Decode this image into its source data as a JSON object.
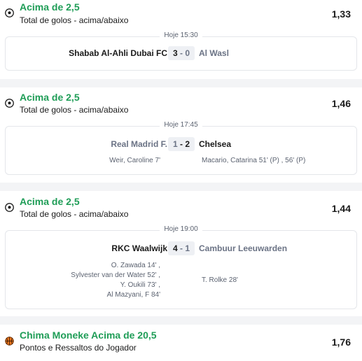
{
  "bets": [
    {
      "selection": "Acima de 2,5",
      "market": "Total de golos - acima/abaixo",
      "odds": "1,33",
      "sport_icon": "soccer-ball-icon",
      "time": "Hoje 15:30",
      "home": "Shabab Al-Ahli Dubai FC",
      "home_score": "3",
      "away_score": "0",
      "away": "Al Wasl",
      "home_scorers": [],
      "away_scorers": []
    },
    {
      "selection": "Acima de 2,5",
      "market": "Total de golos - acima/abaixo",
      "odds": "1,46",
      "sport_icon": "soccer-ball-icon",
      "time": "Hoje 17:45",
      "home": "Real Madrid F.",
      "home_score": "1",
      "away_score": "2",
      "away": "Chelsea",
      "home_scorers": [
        "Weir, Caroline 7'"
      ],
      "away_scorers": [
        "Macario, Catarina 51'  (P) , 56'  (P)"
      ]
    },
    {
      "selection": "Acima de 2,5",
      "market": "Total de golos - acima/abaixo",
      "odds": "1,44",
      "sport_icon": "soccer-ball-icon",
      "time": "Hoje 19:00",
      "home": "RKC Waalwijk",
      "home_score": "4",
      "away_score": "1",
      "away": "Cambuur Leeuwarden",
      "home_scorers": [
        "O. Zawada 14' ,",
        "Sylvester van der Water 52' ,",
        "Y. Oukili 73' ,",
        "Al Mazyani, F 84'"
      ],
      "away_scorers": [
        "T. Rolke 28'"
      ]
    },
    {
      "selection": "Chima Moneke Acima de 20,5",
      "market": "Pontos e Ressaltos do Jogador",
      "odds": "1,76",
      "sport_icon": "basketball-icon"
    }
  ],
  "colors": {
    "selection_green": "#1f9d57",
    "separator": "#f3f4f6",
    "muted": "#6b7385"
  }
}
